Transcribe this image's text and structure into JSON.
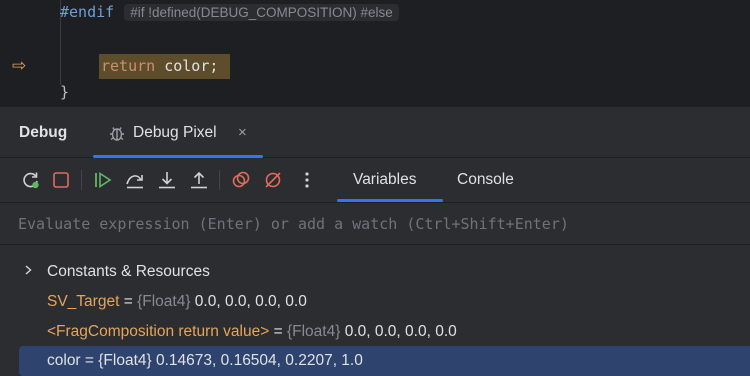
{
  "editor": {
    "endif_directive": "#endif",
    "endif_hint": "#if !defined(DEBUG_COMPOSITION) #else",
    "return_keyword": "return",
    "return_rest": " color;",
    "closing_brace": "}",
    "execution_arrow": "⇨"
  },
  "debug_panel": {
    "title": "Debug",
    "session_tab": {
      "label": "Debug Pixel",
      "close_glyph": "×"
    },
    "toolbar": {
      "icons": [
        "rerun-icon",
        "stop-icon",
        "resume-icon",
        "step-over-icon",
        "step-into-icon",
        "step-out-icon",
        "view-breakpoints-icon",
        "mute-breakpoints-icon",
        "more-icon"
      ],
      "tabs": [
        "Variables",
        "Console"
      ],
      "active_tab": "Variables"
    },
    "evaluate": {
      "placeholder": "Evaluate expression (Enter) or add a watch (Ctrl+Shift+Enter)"
    },
    "variables": {
      "group": {
        "label": "Constants & Resources",
        "expanded": false
      },
      "sv_target": {
        "name": "SV_Target",
        "eq": " = ",
        "type": "{Float4}",
        "value": " 0.0, 0.0, 0.0, 0.0"
      },
      "frag_return": {
        "name": "<FragComposition return value>",
        "eq": " = ",
        "type": "{Float4}",
        "value": " 0.0, 0.0, 0.0, 0.0"
      },
      "color": {
        "text": "color = {Float4} 0.14673, 0.16504, 0.2207, 1.0",
        "selected": true
      }
    }
  },
  "colors": {
    "accent": "#3574f0",
    "selection": "#2e436e",
    "exec_highlight": "#5e4d2a",
    "exec_arrow": "#e0a15c"
  }
}
